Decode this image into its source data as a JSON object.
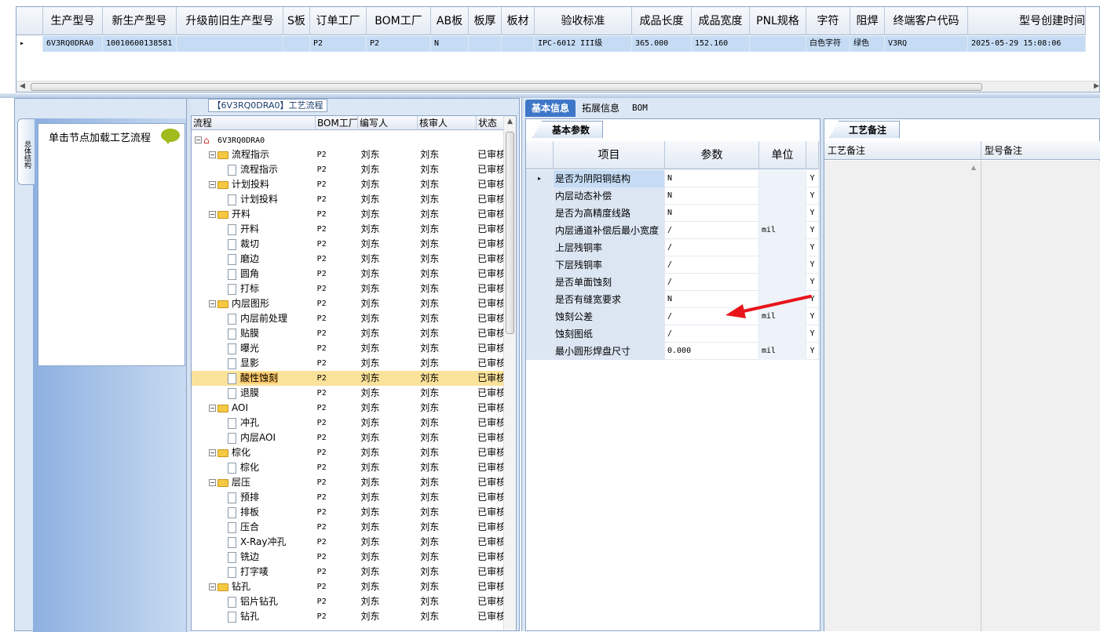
{
  "top_grid": {
    "columns": [
      "生产型号",
      "新生产型号",
      "升级前旧生产型号",
      "S板",
      "订单工厂",
      "BOM工厂",
      "AB板",
      "板厚",
      "板材",
      "验收标准",
      "成品长度",
      "成品宽度",
      "PNL规格",
      "字符",
      "阻焊",
      "终端客户代码",
      "型号创建时间"
    ],
    "row": [
      "6V3RQ0DRA0",
      "10010600138581",
      "",
      "",
      "P2",
      "P2",
      "N",
      "",
      "",
      "IPC-6012 III级",
      "365.000",
      "152.160",
      "",
      "白色字符",
      "绿色",
      "V3RQ",
      "2025-05-29 15:08:06"
    ]
  },
  "left_panel": {
    "title": "【6V3RQ0DRA0】工艺流程",
    "vertical_tab": "总体结构",
    "hint": "单击节点加载工艺流程"
  },
  "tree": {
    "columns": [
      "流程",
      "BOM工厂",
      "编写人",
      "核审人",
      "状态"
    ],
    "root": "6V3RQ0DRA0",
    "rows": [
      {
        "label": "流程指示",
        "type": "folder",
        "bom": "P2",
        "writer": "刘东",
        "reviewer": "刘东",
        "status": "已审核"
      },
      {
        "label": "流程指示",
        "type": "doc",
        "bom": "P2",
        "writer": "刘东",
        "reviewer": "刘东",
        "status": "已审核"
      },
      {
        "label": "计划投料",
        "type": "folder",
        "bom": "P2",
        "writer": "刘东",
        "reviewer": "刘东",
        "status": "已审核"
      },
      {
        "label": "计划投料",
        "type": "doc",
        "bom": "P2",
        "writer": "刘东",
        "reviewer": "刘东",
        "status": "已审核"
      },
      {
        "label": "开料",
        "type": "folder",
        "bom": "P2",
        "writer": "刘东",
        "reviewer": "刘东",
        "status": "已审核"
      },
      {
        "label": "开料",
        "type": "doc",
        "bom": "P2",
        "writer": "刘东",
        "reviewer": "刘东",
        "status": "已审核"
      },
      {
        "label": "裁切",
        "type": "doc",
        "bom": "P2",
        "writer": "刘东",
        "reviewer": "刘东",
        "status": "已审核"
      },
      {
        "label": "磨边",
        "type": "doc",
        "bom": "P2",
        "writer": "刘东",
        "reviewer": "刘东",
        "status": "已审核"
      },
      {
        "label": "圆角",
        "type": "doc",
        "bom": "P2",
        "writer": "刘东",
        "reviewer": "刘东",
        "status": "已审核"
      },
      {
        "label": "打标",
        "type": "doc",
        "bom": "P2",
        "writer": "刘东",
        "reviewer": "刘东",
        "status": "已审核"
      },
      {
        "label": "内层图形",
        "type": "folder",
        "bom": "P2",
        "writer": "刘东",
        "reviewer": "刘东",
        "status": "已审核"
      },
      {
        "label": "内层前处理",
        "type": "doc",
        "bom": "P2",
        "writer": "刘东",
        "reviewer": "刘东",
        "status": "已审核"
      },
      {
        "label": "贴膜",
        "type": "doc",
        "bom": "P2",
        "writer": "刘东",
        "reviewer": "刘东",
        "status": "已审核"
      },
      {
        "label": "曝光",
        "type": "doc",
        "bom": "P2",
        "writer": "刘东",
        "reviewer": "刘东",
        "status": "已审核"
      },
      {
        "label": "显影",
        "type": "doc",
        "bom": "P2",
        "writer": "刘东",
        "reviewer": "刘东",
        "status": "已审核"
      },
      {
        "label": "酸性蚀刻",
        "type": "doc",
        "bom": "P2",
        "writer": "刘东",
        "reviewer": "刘东",
        "status": "已审核",
        "selected": true
      },
      {
        "label": "退膜",
        "type": "doc",
        "bom": "P2",
        "writer": "刘东",
        "reviewer": "刘东",
        "status": "已审核"
      },
      {
        "label": "AOI",
        "type": "folder",
        "bom": "P2",
        "writer": "刘东",
        "reviewer": "刘东",
        "status": "已审核"
      },
      {
        "label": "冲孔",
        "type": "doc",
        "bom": "P2",
        "writer": "刘东",
        "reviewer": "刘东",
        "status": "已审核"
      },
      {
        "label": "内层AOI",
        "type": "doc",
        "bom": "P2",
        "writer": "刘东",
        "reviewer": "刘东",
        "status": "已审核"
      },
      {
        "label": "棕化",
        "type": "folder",
        "bom": "P2",
        "writer": "刘东",
        "reviewer": "刘东",
        "status": "已审核"
      },
      {
        "label": "棕化",
        "type": "doc",
        "bom": "P2",
        "writer": "刘东",
        "reviewer": "刘东",
        "status": "已审核"
      },
      {
        "label": "层压",
        "type": "folder",
        "bom": "P2",
        "writer": "刘东",
        "reviewer": "刘东",
        "status": "已审核"
      },
      {
        "label": "预排",
        "type": "doc",
        "bom": "P2",
        "writer": "刘东",
        "reviewer": "刘东",
        "status": "已审核"
      },
      {
        "label": "排板",
        "type": "doc",
        "bom": "P2",
        "writer": "刘东",
        "reviewer": "刘东",
        "status": "已审核"
      },
      {
        "label": "压合",
        "type": "doc",
        "bom": "P2",
        "writer": "刘东",
        "reviewer": "刘东",
        "status": "已审核"
      },
      {
        "label": "X-Ray冲孔",
        "type": "doc",
        "bom": "P2",
        "writer": "刘东",
        "reviewer": "刘东",
        "status": "已审核"
      },
      {
        "label": "铣边",
        "type": "doc",
        "bom": "P2",
        "writer": "刘东",
        "reviewer": "刘东",
        "status": "已审核"
      },
      {
        "label": "打字唛",
        "type": "doc",
        "bom": "P2",
        "writer": "刘东",
        "reviewer": "刘东",
        "status": "已审核"
      },
      {
        "label": "钻孔",
        "type": "folder",
        "bom": "P2",
        "writer": "刘东",
        "reviewer": "刘东",
        "status": "已审核"
      },
      {
        "label": "铝片钻孔",
        "type": "doc",
        "bom": "P2",
        "writer": "刘东",
        "reviewer": "刘东",
        "status": "已审核"
      },
      {
        "label": "钻孔",
        "type": "doc",
        "bom": "P2",
        "writer": "刘东",
        "reviewer": "刘东",
        "status": "已审核"
      }
    ]
  },
  "tabs": [
    "基本信息",
    "拓展信息",
    "BOM"
  ],
  "basic_params": {
    "subtab": "基本参数",
    "columns": [
      "项目",
      "参数",
      "单位"
    ],
    "rows": [
      {
        "item": "是否为阴阳铜结构",
        "value": "N",
        "unit": "",
        "flag": "Y"
      },
      {
        "item": "内层动态补偿",
        "value": "N",
        "unit": "",
        "flag": "Y"
      },
      {
        "item": "是否为高精度线路",
        "value": "N",
        "unit": "",
        "flag": "Y"
      },
      {
        "item": "内层通道补偿后最小宽度",
        "value": "/",
        "unit": "mil",
        "flag": "Y"
      },
      {
        "item": "上层残铜率",
        "value": "/",
        "unit": "",
        "flag": "Y"
      },
      {
        "item": "下层残铜率",
        "value": "/",
        "unit": "",
        "flag": "Y"
      },
      {
        "item": "是否单面蚀刻",
        "value": "/",
        "unit": "",
        "flag": "Y"
      },
      {
        "item": "是否有缝宽要求",
        "value": "N",
        "unit": "",
        "flag": "Y"
      },
      {
        "item": "蚀刻公差",
        "value": "/",
        "unit": "mil",
        "flag": "Y"
      },
      {
        "item": "蚀刻图纸",
        "value": "/",
        "unit": "",
        "flag": "Y"
      },
      {
        "item": "最小圆形焊盘尺寸",
        "value": "0.000",
        "unit": "mil",
        "flag": "Y"
      }
    ]
  },
  "notes": {
    "subtab": "工艺备注",
    "columns": [
      "工艺备注",
      "型号备注"
    ]
  },
  "colors": {
    "selection": "#c6dcf5",
    "tree_selection": "#fbe29a",
    "tab_active": "#3f77c8",
    "arrow": "#e8141c"
  }
}
